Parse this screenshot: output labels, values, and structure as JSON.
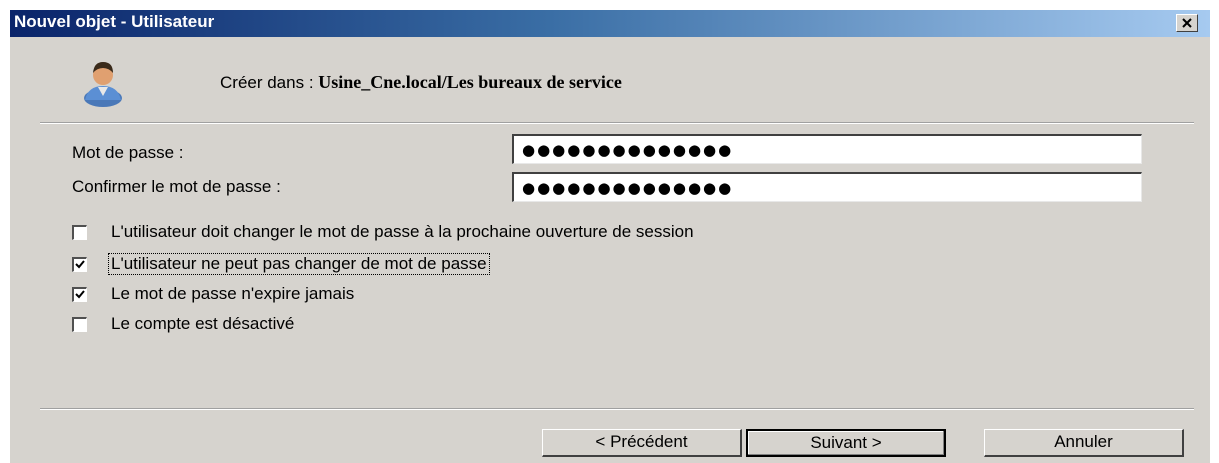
{
  "window": {
    "title": "Nouvel objet - Utilisateur",
    "close_label": "×"
  },
  "header": {
    "create_in_label": "Créer dans : ",
    "create_in_path": "Usine_Cne.local/Les bureaux de service",
    "icon": "user-icon"
  },
  "form": {
    "password_label": "Mot de passe :",
    "password_value": "●●●●●●●●●●●●●●",
    "confirm_label": "Confirmer le mot de passe :",
    "confirm_value": "●●●●●●●●●●●●●●"
  },
  "options": [
    {
      "label": "L'utilisateur doit changer le mot de passe à la prochaine ouverture de session",
      "checked": false
    },
    {
      "label": "L'utilisateur ne peut pas changer de mot de passe",
      "checked": true
    },
    {
      "label": "Le mot de passe n'expire jamais",
      "checked": true
    },
    {
      "label": "Le compte est désactivé",
      "checked": false
    }
  ],
  "buttons": {
    "previous": "< Précédent",
    "next": "Suivant >",
    "cancel": "Annuler"
  }
}
